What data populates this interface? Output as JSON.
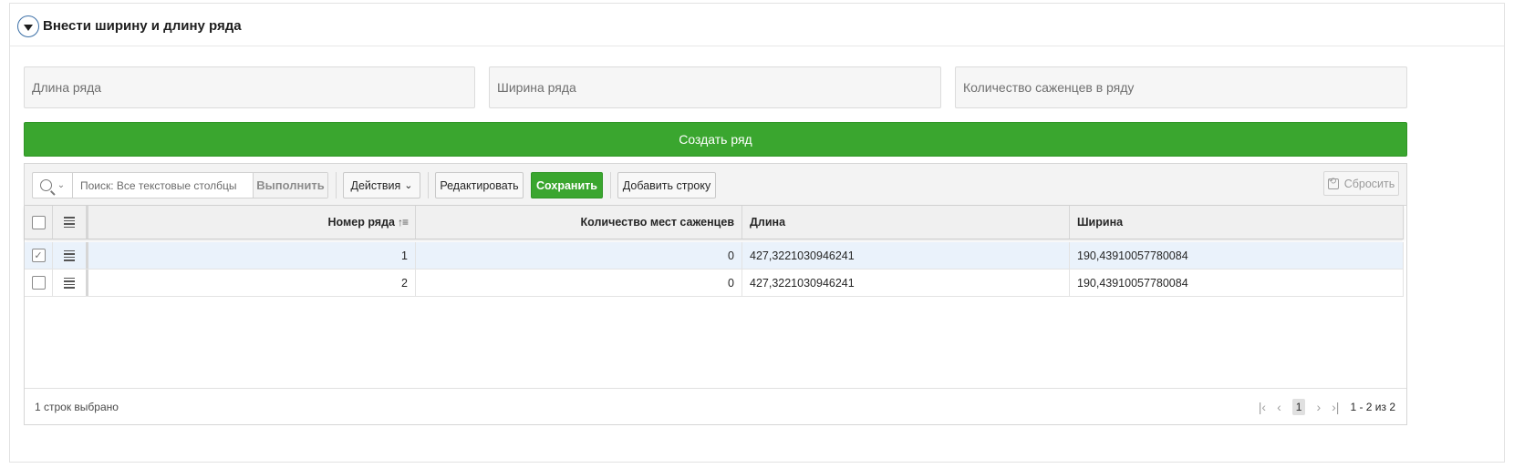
{
  "region": {
    "title": "Внести ширину и длину ряда"
  },
  "form": {
    "length_placeholder": "Длина ряда",
    "width_placeholder": "Ширина ряда",
    "seedlings_placeholder": "Количество саженцев в ряду",
    "create_label": "Создать ряд"
  },
  "toolbar": {
    "search_placeholder": "Поиск: Все текстовые столбцы",
    "run_label": "Выполнить",
    "actions_label": "Действия",
    "edit_label": "Редактировать",
    "save_label": "Сохранить",
    "add_row_label": "Добавить строку",
    "reset_label": "Сбросить"
  },
  "grid": {
    "columns": [
      "Номер ряда",
      "Количество мест саженцев",
      "Длина",
      "Ширина"
    ],
    "rows": [
      {
        "num": "1",
        "places": "0",
        "length": "427,3221030946241",
        "width": "190,43910057780084",
        "selected": true
      },
      {
        "num": "2",
        "places": "0",
        "length": "427,3221030946241",
        "width": "190,43910057780084",
        "selected": false
      }
    ]
  },
  "footer": {
    "selected_text": "1 строк выбрано",
    "current_page": "1",
    "range_text": "1 - 2 из 2"
  },
  "colors": {
    "accent_green": "#3aa62f",
    "selected_row": "#eaf2fb",
    "collapse_ring": "#3b6fa6"
  },
  "icons": [
    "collapse-triangle-icon",
    "search-icon",
    "chevron-down-icon",
    "reset-icon",
    "row-menu-icon",
    "sort-ascending-icon",
    "first-page-icon",
    "prev-page-icon",
    "next-page-icon",
    "last-page-icon"
  ]
}
